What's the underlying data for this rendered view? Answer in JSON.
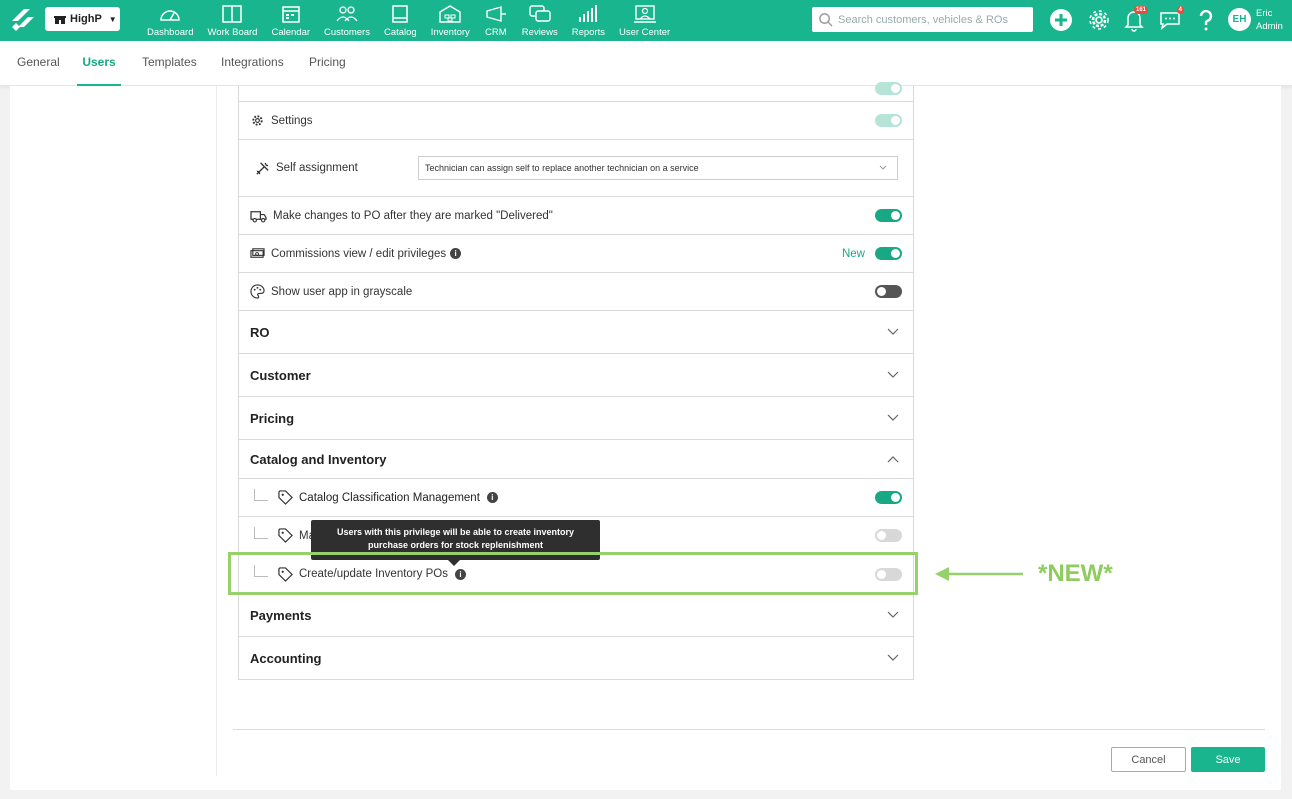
{
  "header": {
    "shop_name": "HighP",
    "nav": [
      {
        "label": "Dashboard",
        "icon": "dashboard-icon"
      },
      {
        "label": "Work Board",
        "icon": "work-board-icon"
      },
      {
        "label": "Calendar",
        "icon": "calendar-icon"
      },
      {
        "label": "Customers",
        "icon": "customers-icon"
      },
      {
        "label": "Catalog",
        "icon": "catalog-icon"
      },
      {
        "label": "Inventory",
        "icon": "inventory-icon"
      },
      {
        "label": "CRM",
        "icon": "crm-icon"
      },
      {
        "label": "Reviews",
        "icon": "reviews-icon"
      },
      {
        "label": "Reports",
        "icon": "reports-icon"
      },
      {
        "label": "User Center",
        "icon": "user-center-icon"
      }
    ],
    "search_placeholder": "Search customers, vehicles & ROs",
    "notifications_count": "161",
    "messages_count": "4",
    "user_initials": "EH",
    "user_name": "Eric",
    "user_role": "Admin"
  },
  "subtabs": [
    {
      "label": "General"
    },
    {
      "label": "Users"
    },
    {
      "label": "Templates"
    },
    {
      "label": "Integrations"
    },
    {
      "label": "Pricing"
    }
  ],
  "active_subtab": "Users",
  "permissions": {
    "settings_label": "Settings",
    "self_assignment_label": "Self assignment",
    "self_assignment_value": "Technician can assign self to replace another technician on a service",
    "po_delivered_label": "Make changes to PO after they are marked \"Delivered\"",
    "commissions_label": "Commissions view / edit privileges",
    "commissions_new_tag": "New",
    "grayscale_label": "Show user app in grayscale"
  },
  "sections": {
    "ro": "RO",
    "customer": "Customer",
    "pricing": "Pricing",
    "catalog_inventory": "Catalog and Inventory",
    "payments": "Payments",
    "accounting": "Accounting"
  },
  "catalog_items": {
    "classification": "Catalog Classification Management",
    "manage_prefix": "Ma",
    "create_pos": "Create/update Inventory POs"
  },
  "tooltip": "Users with this privilege will be able to create inventory purchase orders for stock replenishment",
  "annotation": "*NEW*",
  "buttons": {
    "cancel": "Cancel",
    "save": "Save"
  },
  "colors": {
    "brand": "#18b58e",
    "highlight": "#97d16b"
  }
}
